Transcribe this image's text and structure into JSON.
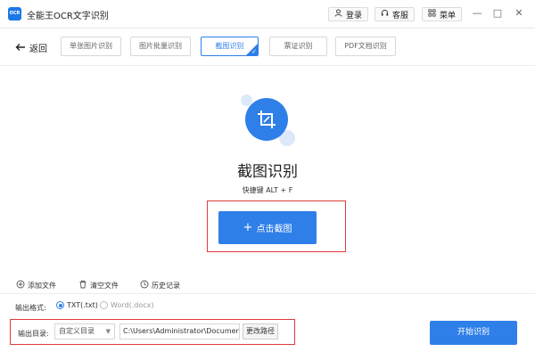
{
  "app": {
    "logo_text": "OCR",
    "title": "全能王OCR文字识别"
  },
  "titlebar": {
    "login": "登录",
    "service": "客服",
    "menu": "菜单",
    "minimize": "—",
    "maximize": "□",
    "close": "✕"
  },
  "nav": {
    "back": "返回",
    "tabs": [
      {
        "label": "单张图片识别",
        "active": false
      },
      {
        "label": "图片批量识别",
        "active": false
      },
      {
        "label": "截图识别",
        "active": true
      },
      {
        "label": "票证识别",
        "active": false
      },
      {
        "label": "PDF文档识别",
        "active": false
      }
    ]
  },
  "main": {
    "title": "截图识别",
    "shortcut": "快捷键 ALT + F",
    "capture_button": "点击截图"
  },
  "actions": {
    "add_file": "添加文件",
    "clear_file": "清空文件",
    "history": "历史记录"
  },
  "output": {
    "format_label": "输出格式:",
    "format_options": [
      {
        "label": "TXT(.txt)",
        "checked": true
      },
      {
        "label": "Word(.docx)",
        "checked": false
      }
    ],
    "dir_label": "输出目录:",
    "dir_select": "自定义目录",
    "dir_path": "C:\\Users\\Administrator\\Documents\\",
    "change_path": "更改路径",
    "start": "开始识别"
  },
  "colors": {
    "accent": "#2f7fe8",
    "highlight_red": "#e03b3b"
  }
}
